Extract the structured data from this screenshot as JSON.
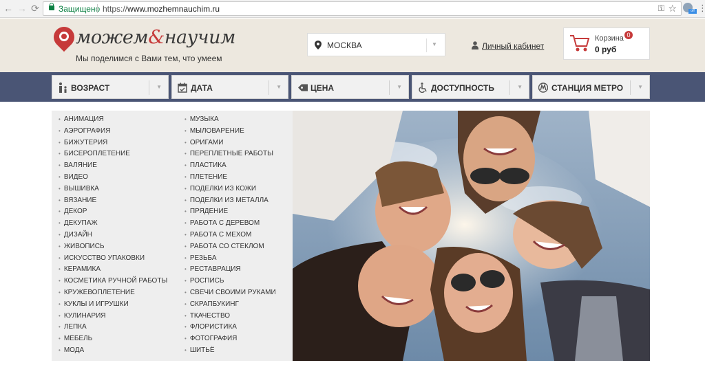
{
  "browser": {
    "secure_label": "Защищено",
    "url_scheme": "https://",
    "url_domain": "www.mozhemnauchim.ru"
  },
  "logo": {
    "word1": "можем",
    "ampersand": "&",
    "word2": "научим",
    "slogan": "Мы поделимся с Вами тем, что умеем"
  },
  "city": {
    "selected": "МОСКВА",
    "icon": "map-pin-icon"
  },
  "account": {
    "label": "Личный кабинет",
    "icon": "user-icon"
  },
  "cart": {
    "label": "Корзина",
    "count": "0",
    "amount": "0 руб",
    "icon": "cart-icon"
  },
  "filters": [
    {
      "label": "ВОЗРАСТ",
      "icon": "age-icon"
    },
    {
      "label": "ДАТА",
      "icon": "calendar-icon"
    },
    {
      "label": "ЦЕНА",
      "icon": "price-tag-icon"
    },
    {
      "label": "ДОСТУПНОСТЬ",
      "icon": "wheelchair-icon"
    },
    {
      "label": "СТАНЦИЯ МЕТРО",
      "icon": "metro-icon"
    }
  ],
  "categories": {
    "column1": [
      "АНИМАЦИЯ",
      "АЭРОГРАФИЯ",
      "БИЖУТЕРИЯ",
      "БИСЕРОПЛЕТЕНИЕ",
      "ВАЛЯНИЕ",
      "ВИДЕО",
      "ВЫШИВКА",
      "ВЯЗАНИЕ",
      "ДЕКОР",
      "ДЕКУПАЖ",
      "ДИЗАЙН",
      "ЖИВОПИСЬ",
      "ИСКУССТВО УПАКОВКИ",
      "КЕРАМИКА",
      "КОСМЕТИКА РУЧНОЙ РАБОТЫ",
      "КРУЖЕВОПЛЕТЕНИЕ",
      "КУКЛЫ И ИГРУШКИ",
      "КУЛИНАРИЯ",
      "ЛЕПКА",
      "МЕБЕЛЬ",
      "МОДА"
    ],
    "column2": [
      "МУЗЫКА",
      "МЫЛОВАРЕНИЕ",
      "ОРИГАМИ",
      "ПЕРЕПЛЕТНЫЕ РАБОТЫ",
      "ПЛАСТИКА",
      "ПЛЕТЕНИЕ",
      "ПОДЕЛКИ ИЗ КОЖИ",
      "ПОДЕЛКИ ИЗ МЕТАЛЛА",
      "ПРЯДЕНИЕ",
      "РАБОТА С ДЕРЕВОМ",
      "РАБОТА С МЕХОМ",
      "РАБОТА СО СТЕКЛОМ",
      "РЕЗЬБА",
      "РЕСТАВРАЦИЯ",
      "РОСПИСЬ",
      "СВЕЧИ СВОИМИ РУКАМИ",
      "СКРАПБУКИНГ",
      "ТКАЧЕСТВО",
      "ФЛОРИСТИКА",
      "ФОТОГРАФИЯ",
      "ШИТЬЁ"
    ]
  },
  "colors": {
    "brand_red": "#c63a3a",
    "filter_bar": "#4a5575",
    "header_bg": "#ede8df"
  }
}
